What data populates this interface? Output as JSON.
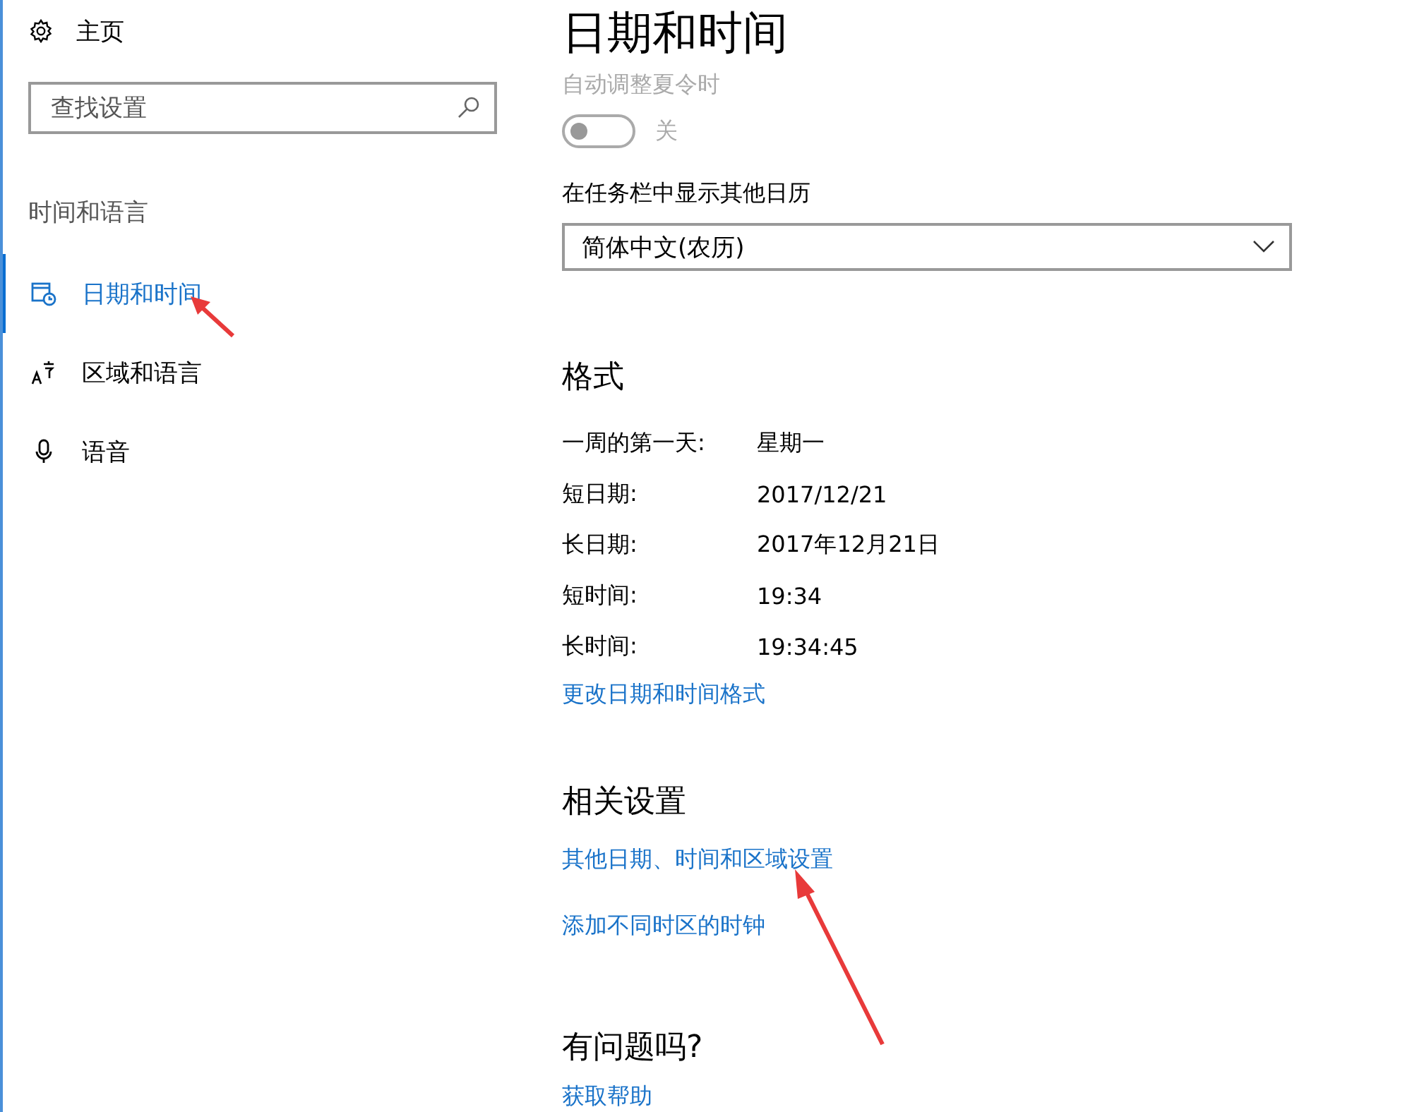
{
  "sidebar": {
    "home": "主页",
    "search": {
      "placeholder": "查找设置"
    },
    "section": "时间和语言",
    "items": [
      {
        "label": "日期和时间",
        "kind": "calendar",
        "selected": true
      },
      {
        "label": "区域和语言",
        "kind": "language",
        "selected": false
      },
      {
        "label": "语音",
        "kind": "microphone",
        "selected": false
      }
    ]
  },
  "page": {
    "title": "日期和时间",
    "dst": {
      "label": "自动调整夏令时",
      "on": false,
      "disabled": true,
      "state_text": "关"
    },
    "calendar": {
      "label": "在任务栏中显示其他日历",
      "value": "简体中文(农历)"
    },
    "format": {
      "heading": "格式",
      "rows": [
        {
          "name": "一周的第一天:",
          "value": "星期一"
        },
        {
          "name": "短日期:",
          "value": "2017/12/21"
        },
        {
          "name": "长日期:",
          "value": "2017年12月21日"
        },
        {
          "name": "短时间:",
          "value": "19:34"
        },
        {
          "name": "长时间:",
          "value": "19:34:45"
        }
      ],
      "link": "更改日期和时间格式"
    },
    "related": {
      "heading": "相关设置",
      "links": [
        "其他日期、时间和区域设置",
        "添加不同时区的时钟"
      ]
    },
    "help": {
      "heading": "有问题吗?",
      "link": "获取帮助"
    }
  }
}
